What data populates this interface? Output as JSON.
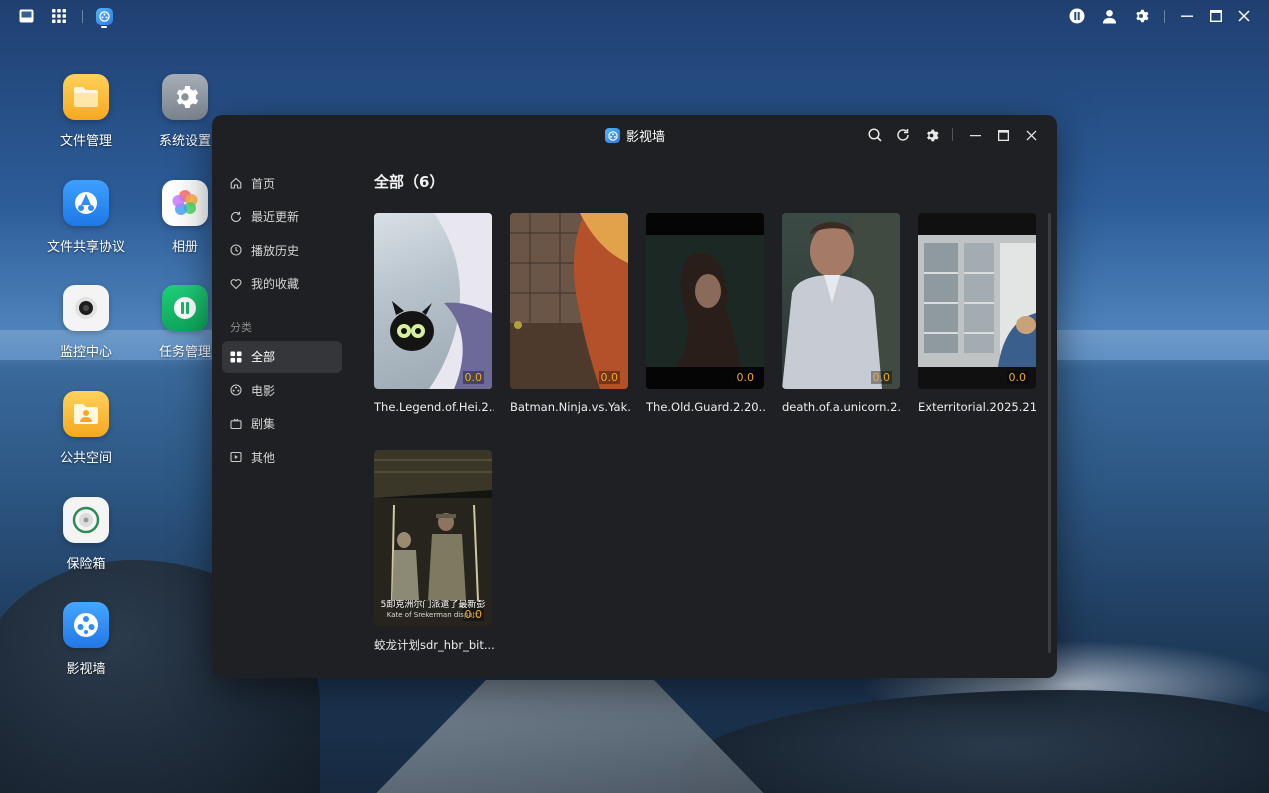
{
  "desktop": {
    "icons": [
      {
        "label": "文件管理",
        "icon": "folder-icon",
        "color": "#f9b53c"
      },
      {
        "label": "系统设置",
        "icon": "gear-icon",
        "color": "#8e959e"
      },
      {
        "label": "文件共享协议",
        "icon": "share-protocol-icon",
        "color": "#2f8df5"
      },
      {
        "label": "相册",
        "icon": "photos-icon",
        "color": "#ffffff"
      },
      {
        "label": "监控中心",
        "icon": "camera-icon",
        "color": "#f2f2f2"
      },
      {
        "label": "任务管理",
        "icon": "task-icon",
        "color": "#16b86a"
      },
      {
        "label": "公共空间",
        "icon": "public-space-icon",
        "color": "#f9b53c"
      },
      {
        "label": "保险箱",
        "icon": "safe-icon",
        "color": "#f2f2f2"
      },
      {
        "label": "影视墙",
        "icon": "video-wall-icon",
        "color": "#2f8df5"
      }
    ]
  },
  "window": {
    "title": "影视墙",
    "sidebar": {
      "nav": [
        {
          "label": "首页",
          "icon": "home-icon"
        },
        {
          "label": "最近更新",
          "icon": "refresh-icon"
        },
        {
          "label": "播放历史",
          "icon": "clock-icon"
        },
        {
          "label": "我的收藏",
          "icon": "heart-icon"
        }
      ],
      "section_label": "分类",
      "categories": [
        {
          "label": "全部",
          "icon": "grid-icon",
          "active": true
        },
        {
          "label": "电影",
          "icon": "film-reel-icon"
        },
        {
          "label": "剧集",
          "icon": "tv-icon"
        },
        {
          "label": "其他",
          "icon": "play-box-icon"
        }
      ]
    },
    "content": {
      "title": "全部（6）",
      "items": [
        {
          "title": "The.Legend.of.Hei.2...",
          "rating": "0.0"
        },
        {
          "title": "Batman.Ninja.vs.Yak...",
          "rating": "0.0"
        },
        {
          "title": "The.Old.Guard.2.20...",
          "rating": "0.0"
        },
        {
          "title": "death.of.a.unicorn.2...",
          "rating": "0.0"
        },
        {
          "title": "Exterritorial.2025.21...",
          "rating": "0.0"
        },
        {
          "title": "蛟龙计划sdr_hbr_bit...",
          "rating": "0.0",
          "subtitle_line1": "5卸克洲尔门派遣了最新彭",
          "subtitle_line2": "Kate of Srekerman dispatc"
        }
      ]
    }
  }
}
